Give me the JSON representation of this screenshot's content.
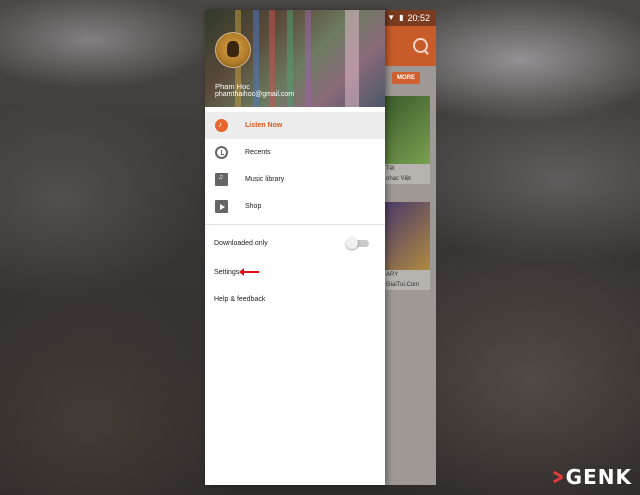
{
  "status_bar": {
    "time": "20:52"
  },
  "background_app": {
    "more_button": "MORE",
    "cards": [
      {
        "caption": "Tết",
        "subcaption": "nhạc Việt"
      },
      {
        "caption": "ARY",
        "subcaption": "GiaiTui.Com"
      }
    ]
  },
  "drawer": {
    "user_name": "Pham Hoc",
    "user_email": "phamthaihoc@gmail.com",
    "items": [
      {
        "label": "Listen Now",
        "icon": "headphones-icon",
        "active": true
      },
      {
        "label": "Recents",
        "icon": "history-icon"
      },
      {
        "label": "Music library",
        "icon": "library-icon"
      },
      {
        "label": "Shop",
        "icon": "shop-icon"
      }
    ],
    "downloaded_only": "Downloaded only",
    "settings": "Settings",
    "help": "Help & feedback"
  },
  "watermark": "GENK",
  "colors": {
    "accent": "#e8642a",
    "annotation_arrow": "#dd1111"
  }
}
